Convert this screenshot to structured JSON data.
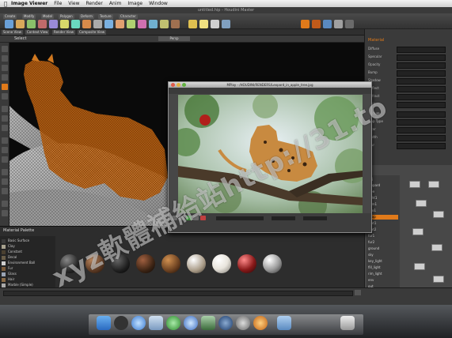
{
  "menubar": {
    "app_name": "Image Viewer",
    "items": [
      "File",
      "View",
      "Render",
      "Anim",
      "Image",
      "Window"
    ]
  },
  "window": {
    "title": "untitled.hip - Houdini Master"
  },
  "shelf": {
    "tabs": [
      "Create",
      "Modify",
      "Model",
      "Polygon",
      "Deform",
      "Texture",
      "Character"
    ]
  },
  "viewport": {
    "label": "Select",
    "projection": "Persp"
  },
  "view_tabs": [
    "Scene View",
    "Context View",
    "Render View",
    "Composite View"
  ],
  "mplay": {
    "title": "MPlay - /HOUDINI/RENDERS/Leopard_in_apple_tree.jpg"
  },
  "material_panel": {
    "title": "Material Palette",
    "items": [
      "Basic Surface",
      "Clay",
      "Constant",
      "Decal",
      "Environment Ball",
      "Fur",
      "Glass",
      "Hair",
      "Marble (Simple)"
    ],
    "swatches": [
      "#3a3a3a",
      "#a8a28f",
      "#4a4030",
      "#6a5e48",
      "#cfcfcf",
      "#7a5a3a",
      "#9aa4b4",
      "#8a6a46",
      "#aaaaaa"
    ],
    "ball_colors": [
      "#2a2a2a",
      "#5c3a24",
      "#1f1f1f",
      "#3c2414",
      "#6a4020",
      "#a89a86",
      "#e8e4dc",
      "#8a1a1a",
      "#9a9a9a"
    ]
  },
  "right_panel": {
    "title": "Material",
    "fields": [
      "Diffuse",
      "Specular",
      "Opacity",
      "Bump",
      "Shadow",
      "Reflect",
      "Refract",
      "Emit",
      "Texture",
      "Map Type",
      "Filter",
      "Width",
      "Blur"
    ]
  },
  "tree": {
    "items": [
      "obj",
      "leopard",
      "tree",
      "light1",
      "cam1",
      "geo1",
      "shop",
      "mat1",
      "mat2",
      "fur1",
      "fur2",
      "ground",
      "sky",
      "key_light",
      "fill_light",
      "rim_light",
      "env",
      "out",
      "mantra1",
      "comp1"
    ]
  },
  "dock_icons": [
    {
      "name": "finder-icon",
      "color": "#4a8ee0"
    },
    {
      "name": "dashboard-icon",
      "color": "#444"
    },
    {
      "name": "safari-icon",
      "color": "#5aa0e8"
    },
    {
      "name": "mail-icon",
      "color": "#8ab0d8"
    },
    {
      "name": "ichat-icon",
      "color": "#3a9a3a"
    },
    {
      "name": "itunes-icon",
      "color": "#6a9ad8"
    },
    {
      "name": "iphoto-icon",
      "color": "#5a8a5a"
    },
    {
      "name": "timemachine-icon",
      "color": "#3a5a8a"
    },
    {
      "name": "preferences-icon",
      "color": "#888"
    },
    {
      "name": "houdini-icon",
      "color": "#e07a1a"
    },
    {
      "name": "folder-icon",
      "color": "#6a9ad8"
    },
    {
      "name": "trash-icon",
      "color": "#aaa"
    }
  ],
  "watermark": "xyz軟體補給站http://31.to",
  "colors": {
    "accent": "#e07a1a",
    "panel": "#3a3a3a"
  }
}
